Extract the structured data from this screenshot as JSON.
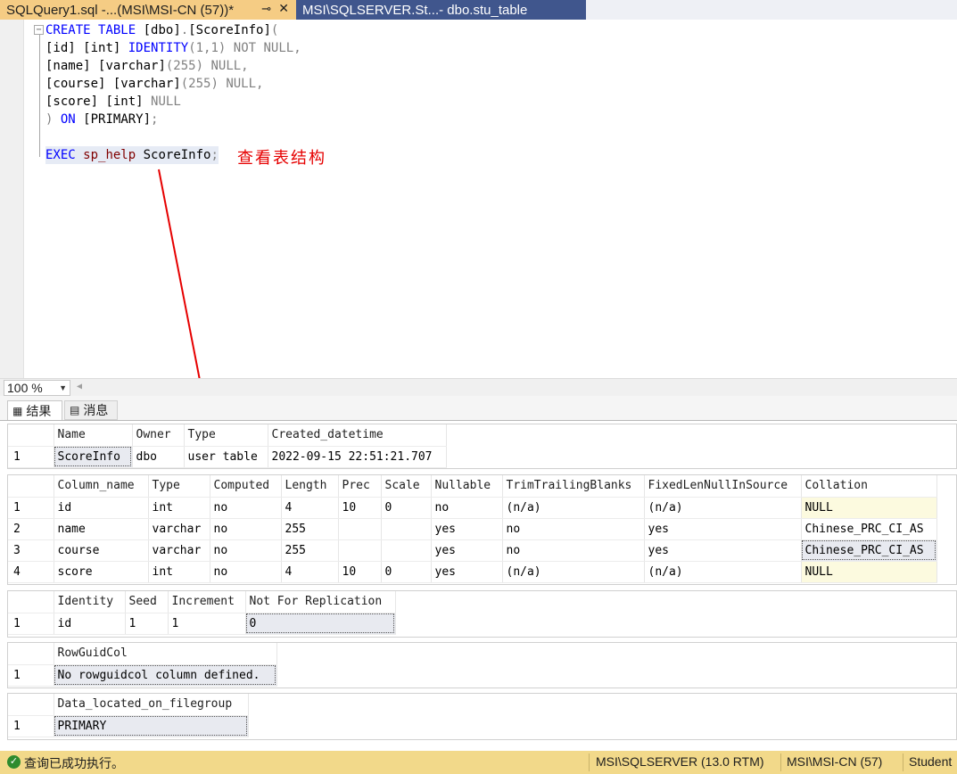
{
  "tabs": {
    "active": {
      "label": "SQLQuery1.sql -...(MSI\\MSI-CN (57))*",
      "pin_icon": "pin-icon",
      "close_icon": "close-icon"
    },
    "inactive": {
      "label": "MSI\\SQLSERVER.St...- dbo.stu_table"
    }
  },
  "editor": {
    "lines": {
      "l1a": "CREATE",
      "l1b": "TABLE",
      "l1c": "[dbo]",
      "l1d": ".",
      "l1e": "[ScoreInfo]",
      "l1f": "(",
      "l2a": "[id]",
      "l2b": "[int]",
      "l2c": "IDENTITY",
      "l2d": "(1,1)",
      "l2e": "NOT NULL,",
      "l3a": "[name]",
      "l3b": "[varchar]",
      "l3c": "(255)",
      "l3d": "NULL,",
      "l4a": "[course]",
      "l4b": "[varchar]",
      "l4c": "(255)",
      "l4d": "NULL,",
      "l5a": "[score]",
      "l5b": "[int]",
      "l5c": "NULL",
      "l6a": ")",
      "l6b": "ON",
      "l6c": "[PRIMARY]",
      "l6d": ";",
      "l8a": "EXEC",
      "l8b": "sp_help",
      "l8c": "ScoreInfo",
      "l8d": ";"
    },
    "annotation": "查看表结构"
  },
  "zoom": {
    "value": "100 %"
  },
  "result_tabs": {
    "results": "结果",
    "messages": "消息"
  },
  "grids": {
    "g1": {
      "headers": [
        "Name",
        "Owner",
        "Type",
        "Created_datetime"
      ],
      "rows": [
        [
          "1",
          "ScoreInfo",
          "dbo",
          "user table",
          "2022-09-15 22:51:21.707"
        ]
      ]
    },
    "g2": {
      "headers": [
        "Column_name",
        "Type",
        "Computed",
        "Length",
        "Prec",
        "Scale",
        "Nullable",
        "TrimTrailingBlanks",
        "FixedLenNullInSource",
        "Collation"
      ],
      "rows": [
        [
          "1",
          "id",
          "int",
          "no",
          "4",
          "10",
          "0",
          "no",
          "(n/a)",
          "(n/a)",
          "NULL"
        ],
        [
          "2",
          "name",
          "varchar",
          "no",
          "255",
          "",
          "",
          "yes",
          "no",
          "yes",
          "Chinese_PRC_CI_AS"
        ],
        [
          "3",
          "course",
          "varchar",
          "no",
          "255",
          "",
          "",
          "yes",
          "no",
          "yes",
          "Chinese_PRC_CI_AS"
        ],
        [
          "4",
          "score",
          "int",
          "no",
          "4",
          "10",
          "0",
          "yes",
          "(n/a)",
          "(n/a)",
          "NULL"
        ]
      ]
    },
    "g3": {
      "headers": [
        "Identity",
        "Seed",
        "Increment",
        "Not For Replication"
      ],
      "rows": [
        [
          "1",
          "id",
          "1",
          "1",
          "0"
        ]
      ]
    },
    "g4": {
      "headers": [
        "RowGuidCol"
      ],
      "rows": [
        [
          "1",
          "No rowguidcol column defined."
        ]
      ]
    },
    "g5": {
      "headers": [
        "Data_located_on_filegroup"
      ],
      "rows": [
        [
          "1",
          "PRIMARY"
        ]
      ]
    }
  },
  "status": {
    "message": "查询已成功执行。",
    "server": "MSI\\SQLSERVER (13.0 RTM)",
    "user": "MSI\\MSI-CN (57)",
    "database": "Student"
  },
  "colors": {
    "annotation": "#e60000",
    "status_bar": "#f2d98a",
    "active_tab": "#f5cc84",
    "inactive_tab": "#40568d"
  }
}
